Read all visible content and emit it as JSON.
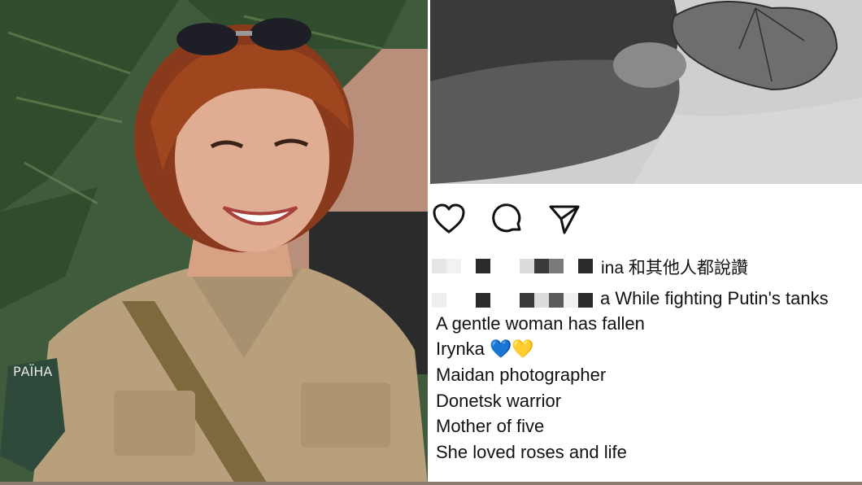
{
  "left_image": {
    "alt": "smiling woman with short auburn hair wearing a khaki uniform and sunglasses on head",
    "patch_text": "РАЇНА"
  },
  "post_image": {
    "alt": "black-and-white photo of fingers holding a dried leaf"
  },
  "actions": {
    "like_icon": "heart-icon",
    "comment_icon": "comment-icon",
    "share_icon": "send-icon"
  },
  "likes": {
    "text": "ina 和其他人都說讚"
  },
  "caption": {
    "first_line": "a While fighting Putin's tanks",
    "lines": [
      "A gentle woman has fallen",
      "Irynka 💙💛",
      "Maidan photographer",
      "Donetsk warrior",
      "Mother of five",
      "She loved roses and life"
    ]
  }
}
